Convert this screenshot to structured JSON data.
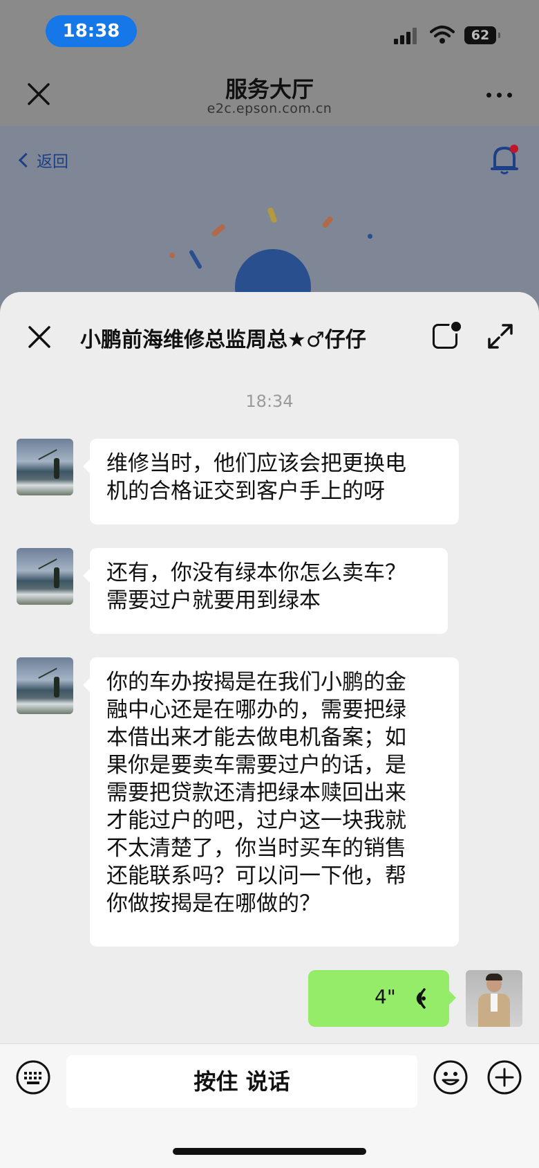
{
  "status_bar": {
    "time": "18:38",
    "battery": "62"
  },
  "web_page": {
    "title": "服务大厅",
    "domain": "e2c.epson.com.cn",
    "back_label": "返回"
  },
  "chat": {
    "title": "小鹏前海维修总监周总★♂仔仔",
    "timestamp": "18:34",
    "messages": [
      {
        "sender": "peer",
        "lines": [
          "维修当时，他们应该会把更换电",
          "机的合格证交到客户手上的呀"
        ]
      },
      {
        "sender": "peer",
        "lines": [
          "还有，你没有绿本你怎么卖车？",
          "需要过户就要用到绿本"
        ]
      },
      {
        "sender": "peer",
        "lines": [
          "你的车办按揭是在我们小鹏的金",
          "融中心还是在哪办的，需要把绿",
          "本借出来才能去做电机备案；如",
          "果你是要卖车需要过户的话，是",
          "需要把贷款还清把绿本赎回出来",
          "才能过户的吧，过户这一块我就",
          "不太清楚了，你当时买车的销售",
          "还能联系吗？可以问一下他，帮",
          "你做按揭是在哪做的？"
        ]
      }
    ],
    "voice_message": {
      "sender": "self",
      "duration": "4\""
    },
    "input": {
      "talk_label": "按住 说话"
    }
  },
  "colors": {
    "time_pill": "#1577e8",
    "voice_bubble": "#95ec69",
    "bell_dot": "#c0152a"
  }
}
